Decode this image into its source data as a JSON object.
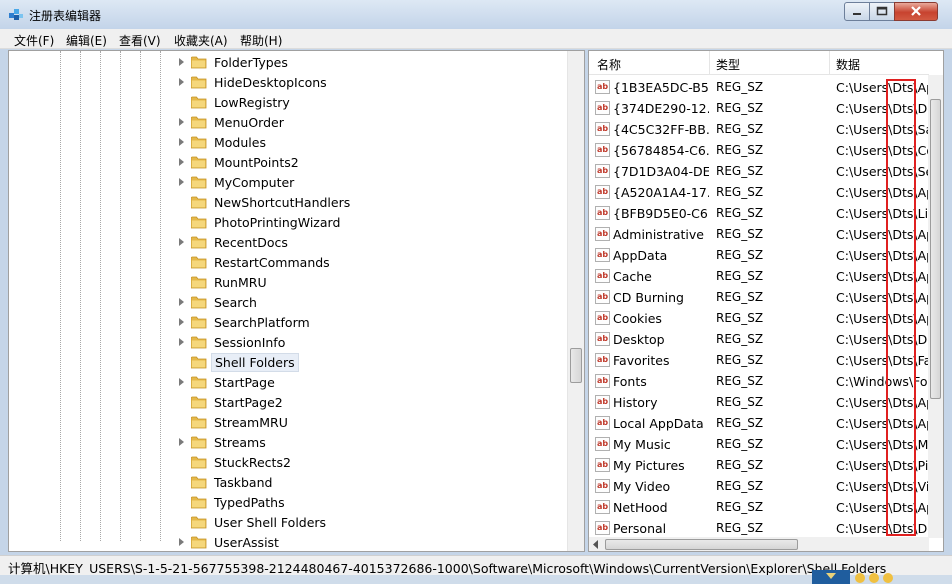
{
  "window": {
    "title": "注册表编辑器"
  },
  "menu": [
    "文件(F)",
    "编辑(E)",
    "查看(V)",
    "收藏夹(A)",
    "帮助(H)"
  ],
  "tree": {
    "items": [
      {
        "label": "FolderTypes",
        "expandable": true
      },
      {
        "label": "HideDesktopIcons",
        "expandable": true
      },
      {
        "label": "LowRegistry",
        "expandable": false
      },
      {
        "label": "MenuOrder",
        "expandable": true
      },
      {
        "label": "Modules",
        "expandable": true
      },
      {
        "label": "MountPoints2",
        "expandable": true
      },
      {
        "label": "MyComputer",
        "expandable": true
      },
      {
        "label": "NewShortcutHandlers",
        "expandable": false
      },
      {
        "label": "PhotoPrintingWizard",
        "expandable": false
      },
      {
        "label": "RecentDocs",
        "expandable": true
      },
      {
        "label": "RestartCommands",
        "expandable": false
      },
      {
        "label": "RunMRU",
        "expandable": false
      },
      {
        "label": "Search",
        "expandable": true
      },
      {
        "label": "SearchPlatform",
        "expandable": true
      },
      {
        "label": "SessionInfo",
        "expandable": true
      },
      {
        "label": "Shell Folders",
        "expandable": false,
        "selected": true
      },
      {
        "label": "StartPage",
        "expandable": true
      },
      {
        "label": "StartPage2",
        "expandable": false
      },
      {
        "label": "StreamMRU",
        "expandable": false
      },
      {
        "label": "Streams",
        "expandable": true
      },
      {
        "label": "StuckRects2",
        "expandable": false
      },
      {
        "label": "Taskband",
        "expandable": false
      },
      {
        "label": "TypedPaths",
        "expandable": false
      },
      {
        "label": "User Shell Folders",
        "expandable": false
      },
      {
        "label": "UserAssist",
        "expandable": true
      }
    ]
  },
  "values": {
    "columns": {
      "name": "名称",
      "type": "类型",
      "data": "数据"
    },
    "rows": [
      {
        "name": "{1B3EA5DC-B5...",
        "type": "REG_SZ",
        "data": "C:\\Users\\Dts\\Ap"
      },
      {
        "name": "{374DE290-12...",
        "type": "REG_SZ",
        "data": "C:\\Users\\Dts\\Do"
      },
      {
        "name": "{4C5C32FF-BB...",
        "type": "REG_SZ",
        "data": "C:\\Users\\Dts\\Sa"
      },
      {
        "name": "{56784854-C6...",
        "type": "REG_SZ",
        "data": "C:\\Users\\Dts\\Co"
      },
      {
        "name": "{7D1D3A04-DE...",
        "type": "REG_SZ",
        "data": "C:\\Users\\Dts\\Se"
      },
      {
        "name": "{A520A1A4-17...",
        "type": "REG_SZ",
        "data": "C:\\Users\\Dts\\Ap"
      },
      {
        "name": "{BFB9D5E0-C6...",
        "type": "REG_SZ",
        "data": "C:\\Users\\Dts\\Lir"
      },
      {
        "name": "Administrative ...",
        "type": "REG_SZ",
        "data": "C:\\Users\\Dts\\Ap"
      },
      {
        "name": "AppData",
        "type": "REG_SZ",
        "data": "C:\\Users\\Dts\\Ap"
      },
      {
        "name": "Cache",
        "type": "REG_SZ",
        "data": "C:\\Users\\Dts\\Ap"
      },
      {
        "name": "CD Burning",
        "type": "REG_SZ",
        "data": "C:\\Users\\Dts\\Ap"
      },
      {
        "name": "Cookies",
        "type": "REG_SZ",
        "data": "C:\\Users\\Dts\\Ap"
      },
      {
        "name": "Desktop",
        "type": "REG_SZ",
        "data": "C:\\Users\\Dts\\De"
      },
      {
        "name": "Favorites",
        "type": "REG_SZ",
        "data": "C:\\Users\\Dts\\Fa"
      },
      {
        "name": "Fonts",
        "type": "REG_SZ",
        "data": "C:\\Windows\\Fo"
      },
      {
        "name": "History",
        "type": "REG_SZ",
        "data": "C:\\Users\\Dts\\Ap"
      },
      {
        "name": "Local AppData",
        "type": "REG_SZ",
        "data": "C:\\Users\\Dts\\Ap"
      },
      {
        "name": "My Music",
        "type": "REG_SZ",
        "data": "C:\\Users\\Dts\\M"
      },
      {
        "name": "My Pictures",
        "type": "REG_SZ",
        "data": "C:\\Users\\Dts\\Pic"
      },
      {
        "name": "My Video",
        "type": "REG_SZ",
        "data": "C:\\Users\\Dts\\Vi"
      },
      {
        "name": "NetHood",
        "type": "REG_SZ",
        "data": "C:\\Users\\Dts\\Ap"
      },
      {
        "name": "Personal",
        "type": "REG_SZ",
        "data": "C:\\Users\\Dts\\Do"
      }
    ]
  },
  "status": {
    "path": "计算机\\HKEY_USERS\\S-1-5-21-567755398-2124480467-4015372686-1000\\Software\\Microsoft\\Windows\\CurrentVersion\\Explorer\\Shell Folders"
  },
  "colors": {
    "selection_bg": "#e8eef7",
    "highlight_box": "#e02020",
    "folder": "#e8c05a"
  }
}
